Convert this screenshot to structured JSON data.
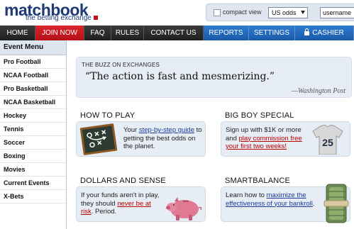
{
  "header": {
    "logo": "matchbook",
    "tagline": "the betting exchange",
    "compact_view_label": "compact view",
    "odds_selected": "US odds",
    "username_placeholder": "username"
  },
  "nav": {
    "items": [
      "HOME",
      "JOIN NOW",
      "FAQ",
      "RULES",
      "CONTACT US",
      "REPORTS",
      "SETTINGS",
      "CASHIER"
    ]
  },
  "sidebar": {
    "title": "Event Menu",
    "items": [
      "Pro Football",
      "NCAA Football",
      "Pro Basketball",
      "NCAA Basketball",
      "Hockey",
      "Tennis",
      "Soccer",
      "Boxing",
      "Movies",
      "Current Events",
      "X-Bets"
    ]
  },
  "buzz": {
    "label": "THE BUZZ ON EXCHANGES",
    "quote": "“The action is fast and mesmerizing.”",
    "source": "—Washington Post"
  },
  "sections": {
    "how_to_play": {
      "title": "HOW TO PLAY",
      "text1": "Your ",
      "link": "step-by-step guide",
      "text2": " to getting the best odds on the planet."
    },
    "big_boy": {
      "title": "BIG BOY SPECIAL",
      "text1": "Sign up with $1K or more and ",
      "link": "play commission free your first two weeks!",
      "jersey_number": "25"
    },
    "dollars": {
      "title": "DOLLARS AND SENSE",
      "text1": "If your funds aren't in play, they should ",
      "link": "never be at risk",
      "text2": ". Period."
    },
    "smartbalance": {
      "title": "SMARTBALANCE",
      "text1": "Learn how to ",
      "link": "maximize the effectiveness of your bankroll",
      "text2": "."
    }
  },
  "colors": {
    "brand_navy": "#1e3a78",
    "join_red": "#c8161d",
    "nav_blue": "#2468be",
    "panel_bg": "#e7edf5"
  }
}
